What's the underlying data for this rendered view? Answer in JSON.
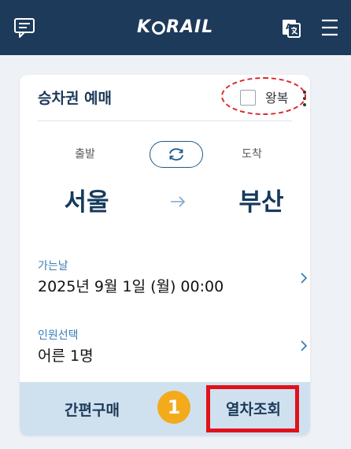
{
  "header": {
    "logo_text_left": "K",
    "logo_text_right": "RAIL",
    "chat_icon": "chat-icon",
    "translate_icon": "translate-icon",
    "menu_icon": "hamburger-menu-icon"
  },
  "booking": {
    "title": "승차권 예매",
    "roundtrip_label": "왕복",
    "roundtrip_checked": false,
    "departure_label": "출발",
    "arrival_label": "도착",
    "departure_station": "서울",
    "arrival_station": "부산",
    "date_label": "가는날",
    "date_value": "2025년 9월 1일 (월) 00:00",
    "passenger_label": "인원선택",
    "passenger_value": "어른 1명",
    "quick_buy_label": "간편구매",
    "search_train_label": "열차조회"
  },
  "annotation": {
    "step_number": "1"
  },
  "colors": {
    "header_bg": "#1d3a5a",
    "accent_blue": "#3a7fb8",
    "bottom_bar": "#cfe1ef",
    "annotation_red": "#e0111b",
    "badge_orange": "#f3ab1b"
  }
}
